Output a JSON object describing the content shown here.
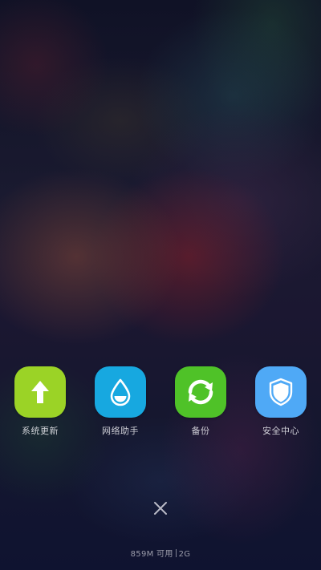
{
  "colors": {
    "system_update": "#9bd326",
    "network_assistant": "#17a8e0",
    "backup": "#4fc228",
    "security_center": "#4fa9f6"
  },
  "tiles": [
    {
      "label": "系统更新",
      "icon": "arrow-up-icon"
    },
    {
      "label": "网络助手",
      "icon": "water-drop-icon"
    },
    {
      "label": "备份",
      "icon": "sync-icon"
    },
    {
      "label": "安全中心",
      "icon": "shield-icon"
    }
  ],
  "close": {
    "icon": "close-icon"
  },
  "status": {
    "memory": "859M 可用",
    "network": "2G"
  }
}
